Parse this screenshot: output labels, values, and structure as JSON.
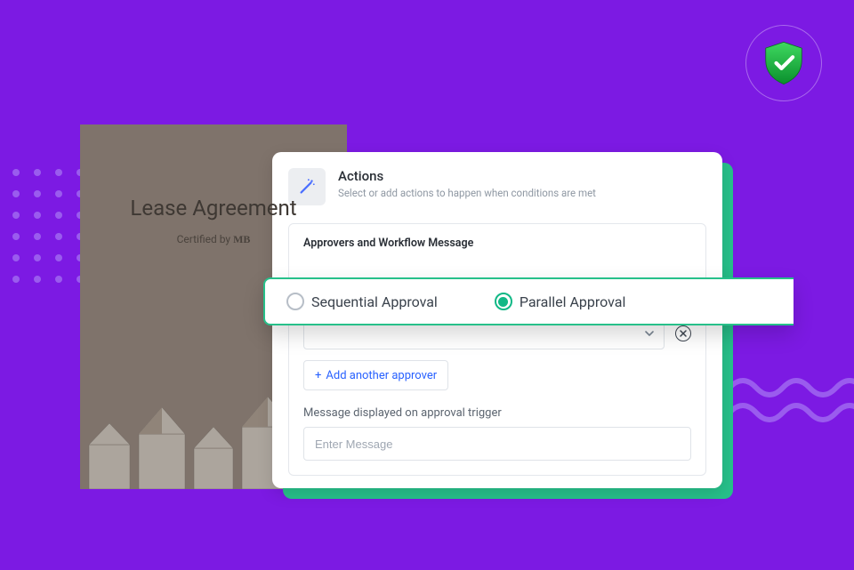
{
  "doc": {
    "title": "Lease Agreement",
    "certified_prefix": "Certified by ",
    "certified_logo": "MB"
  },
  "card": {
    "heading": "Actions",
    "subheading": "Select or add actions to happen when conditions are met",
    "panel_title": "Approvers and Workflow Message",
    "add_label": "Add another approver",
    "plus": "+",
    "message_label": "Message displayed on approval trigger",
    "message_placeholder": "Enter Message"
  },
  "radios": {
    "sequential": "Sequential Approval",
    "parallel": "Parallel Approval"
  },
  "icons": {
    "wand": "wand-icon",
    "shield": "shield-check-icon",
    "chevron": "chevron-down-icon",
    "close": "close-circle-icon"
  },
  "colors": {
    "bg": "#7c1ae3",
    "accent": "#27c08a",
    "link": "#2962ff"
  }
}
